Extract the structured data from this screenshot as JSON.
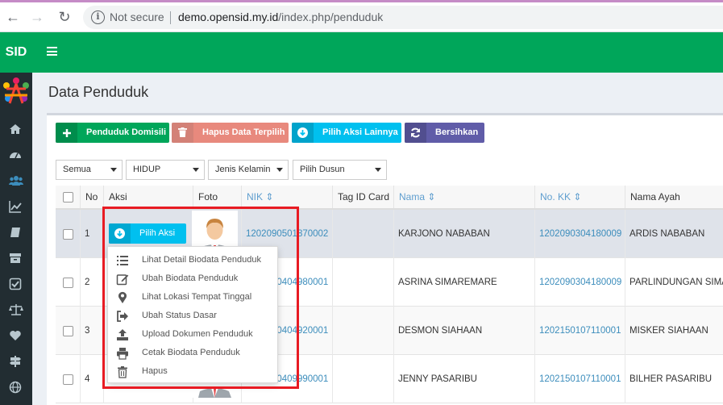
{
  "browser": {
    "security_label": "Not secure",
    "url_host": "demo.opensid.my.id",
    "url_path": "/index.php/penduduk"
  },
  "app": {
    "logo_text": "SID",
    "accent_color": "#00a65a"
  },
  "sidebar": {
    "items": [
      {
        "icon": "home-icon"
      },
      {
        "icon": "dashboard-icon"
      },
      {
        "icon": "users-icon",
        "active": true
      },
      {
        "icon": "chart-icon"
      },
      {
        "icon": "book-icon"
      },
      {
        "icon": "archive-icon"
      },
      {
        "icon": "check-square-icon"
      },
      {
        "icon": "balance-scale-icon"
      },
      {
        "icon": "heart-icon"
      },
      {
        "icon": "signpost-icon"
      },
      {
        "icon": "globe-icon"
      }
    ]
  },
  "page": {
    "title": "Data Penduduk"
  },
  "toolbar": {
    "buttons": [
      {
        "label": "Penduduk Domisili",
        "icon": "plus-icon"
      },
      {
        "label": "Hapus Data Terpilih",
        "icon": "trash-icon"
      },
      {
        "label": "Pilih Aksi Lainnya",
        "icon": "arrow-circle-down-icon"
      },
      {
        "label": "Bersihkan",
        "icon": "refresh-icon"
      }
    ]
  },
  "filters": {
    "status": "Semua",
    "hidup": "HIDUP",
    "gender": "Jenis Kelamin",
    "dusun": "Pilih Dusun"
  },
  "table": {
    "headers": {
      "no": "No",
      "aksi": "Aksi",
      "foto": "Foto",
      "nik": "NIK",
      "tag": "Tag ID Card",
      "nama": "Nama",
      "kk": "No. KK",
      "ayah": "Nama Ayah"
    },
    "rows": [
      {
        "no": "1",
        "nik": "1202090501870002",
        "nama": "KARJONO NABABAN",
        "kk": "1202090304180009",
        "ayah": "ARDIS NABABAN"
      },
      {
        "no": "2",
        "nik": "1202090404980001",
        "nama": "ASRINA SIMAREMARE",
        "kk": "1202090304180009",
        "ayah": "PARLINDUNGAN SIMAREMARE"
      },
      {
        "no": "3",
        "nik": "1202090404920001",
        "nama": "DESMON SIAHAAN",
        "kk": "1202150107110001",
        "ayah": "MISKER SIAHAAN"
      },
      {
        "no": "4",
        "nik": "1202090409990001",
        "nama": "JENNY PASARIBU",
        "kk": "1202150107110001",
        "ayah": "BILHER PASARIBU"
      }
    ],
    "action_button": "Pilih Aksi"
  },
  "action_menu": {
    "items": [
      {
        "label": "Lihat Detail Biodata Penduduk",
        "icon": "list-icon"
      },
      {
        "label": "Ubah Biodata Penduduk",
        "icon": "edit-icon"
      },
      {
        "label": "Lihat Lokasi Tempat Tinggal",
        "icon": "map-marker-icon"
      },
      {
        "label": "Ubah Status Dasar",
        "icon": "sign-out-icon"
      },
      {
        "label": "Upload Dokumen Penduduk",
        "icon": "upload-icon"
      },
      {
        "label": "Cetak Biodata Penduduk",
        "icon": "print-icon"
      },
      {
        "label": "Hapus",
        "icon": "trash-icon"
      }
    ]
  }
}
